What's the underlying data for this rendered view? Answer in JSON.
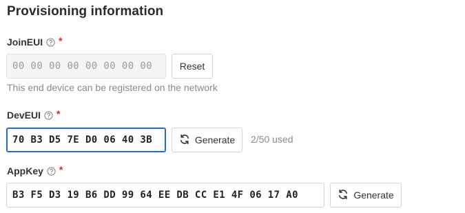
{
  "section": {
    "title": "Provisioning information"
  },
  "join_eui": {
    "label": "JoinEUI",
    "required_mark": "*",
    "value": "00 00 00 00 00 00 00 00",
    "reset_label": "Reset",
    "description": "This end device can be registered on the network"
  },
  "dev_eui": {
    "label": "DevEUI",
    "required_mark": "*",
    "value": "70 B3 D5 7E D0 06 40 3B",
    "generate_label": "Generate",
    "usage": "2/50 used"
  },
  "app_key": {
    "label": "AppKey",
    "required_mark": "*",
    "value": "B3 F5 D3 19 B6 DD 99 64 EE DB CC E1 4F 06 17 A0",
    "generate_label": "Generate"
  },
  "colors": {
    "focus": "#1e6bd6",
    "required": "#db2424",
    "muted_text": "#8a8a8a",
    "border": "#d5d5d5"
  },
  "icons": {
    "help": "help-circle-icon",
    "generate": "refresh-icon"
  }
}
